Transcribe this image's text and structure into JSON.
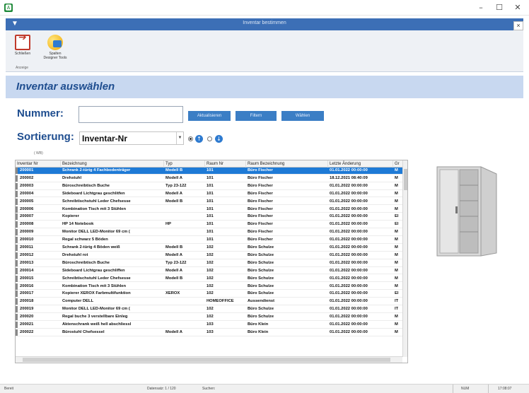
{
  "window": {
    "app_icon": "🅰",
    "minimize": "–",
    "maximize": "☐",
    "close": "✕"
  },
  "ribbon_window": {
    "qat": "▼",
    "caption": "Inventar bestimmen",
    "close": "×",
    "buttons": [
      {
        "label": "Schließen",
        "icon": "exit-icon"
      },
      {
        "label": "Spalten Designer Tools",
        "icon": "designer-icon"
      }
    ],
    "group_label": "Anzeige"
  },
  "heading": "Inventar auswählen",
  "search": {
    "nummer_label": "Nummer:",
    "nummer_value": "",
    "buttons": [
      "Aktualisieren",
      "Filtern",
      "Wählen"
    ]
  },
  "sort": {
    "label": "Sortierung:",
    "selected": "Inventar-Nr",
    "order": "ascending"
  },
  "tiny_label": "( WB)",
  "grid": {
    "columns": [
      "Inventar Nr",
      "Bezeichnung",
      "Typ",
      "Raum Nr",
      "Raum Bezeichnung",
      "Letzte Änderung",
      "Gr"
    ],
    "rows": [
      [
        "200001",
        "Schrank 2-türig 4 Fachbodenträger",
        "Modell B",
        "101",
        "Büro Fischer",
        "01.01.2022 00:00:00",
        "M"
      ],
      [
        "200002",
        "Drehstuhl",
        "Modell A",
        "101",
        "Büro Fischer",
        "18.12.2021 08:40:09",
        "M"
      ],
      [
        "200003",
        "Büroschreibtisch Buche",
        "Typ 23-122",
        "101",
        "Büro Fischer",
        "01.01.2022 00:00:00",
        "M"
      ],
      [
        "200004",
        "Sideboard Lichtgrau geschlitfen",
        "Modell A",
        "101",
        "Büro Fischer",
        "01.01.2022 00:00:00",
        "M"
      ],
      [
        "200005",
        "Schreibtischstuhl Leder Chefsesse",
        "Modell B",
        "101",
        "Büro Fischer",
        "01.01.2022 00:00:00",
        "M"
      ],
      [
        "200006",
        "Kombination Tisch mit 3 Stühlen",
        "",
        "101",
        "Büro Fischer",
        "01.01.2022 00:00:00",
        "M"
      ],
      [
        "200007",
        "Kopierer",
        "",
        "101",
        "Büro Fischer",
        "01.01.2022 00:00:00",
        "El"
      ],
      [
        "200008",
        "HP 14 Notebook",
        "HP",
        "101",
        "Büro Fischer",
        "01.01.2022 00:00:00",
        "El"
      ],
      [
        "200009",
        "Monitor DELL LED-Monitor 69 cm (",
        "",
        "101",
        "Büro Fischer",
        "01.01.2022 00:00:00",
        "M"
      ],
      [
        "200010",
        "Regal schwarz 5 Böden",
        "",
        "101",
        "Büro Fischer",
        "01.01.2022 00:00:00",
        "M"
      ],
      [
        "200011",
        "Schrank 2-türig 4 Böden weiß",
        "Modell B",
        "102",
        "Büro Schulze",
        "01.01.2022 00:00:00",
        "M"
      ],
      [
        "200012",
        "Drehstuhl rot",
        "Modell A",
        "102",
        "Büro Schulze",
        "01.01.2022 00:00:00",
        "M"
      ],
      [
        "200013",
        "Büroschreibtisch Buche",
        "Typ 23-122",
        "102",
        "Büro Schulze",
        "01.01.2022 00:00:00",
        "M"
      ],
      [
        "200014",
        "Sideboard Lichtgrau geschliffen",
        "Modell A",
        "102",
        "Büro Schulze",
        "01.01.2022 00:00:00",
        "M"
      ],
      [
        "200015",
        "Schreibtischstuhl Leder Chefsesse",
        "Modell B",
        "102",
        "Büro Schulze",
        "01.01.2022 00:00:00",
        "M"
      ],
      [
        "200016",
        "Kombination Tisch mit 3 Stühlen",
        "",
        "102",
        "Büro Schulze",
        "01.01.2022 00:00:00",
        "M"
      ],
      [
        "200017",
        "Kopierer XEROX Farbmultifunktion",
        "XEROX",
        "102",
        "Büro Schulze",
        "01.01.2022 00:00:00",
        "El"
      ],
      [
        "200018",
        "Computer DELL",
        "",
        "HOMEOFFICE",
        "Aussendienst",
        "01.01.2022 00:00:00",
        "IT"
      ],
      [
        "200019",
        "Monitor DELL LED-Monitor 69 cm (",
        "",
        "102",
        "Büro Schulze",
        "01.01.2022 00:00:00",
        "IT"
      ],
      [
        "200020",
        "Regal buche 3 verstellbare Einleg",
        "",
        "102",
        "Büro Schulze",
        "01.01.2022 00:00:00",
        "M"
      ],
      [
        "200021",
        "Aktenschrank weiß hell abschliessl",
        "",
        "103",
        "Büro Klein",
        "01.01.2022 00:00:00",
        "M"
      ],
      [
        "200022",
        "Bürostuhl Chefsessel",
        "Modell A",
        "103",
        "Büro Klein",
        "01.01.2022 00:00:00",
        "M"
      ]
    ]
  },
  "statusbar": [
    "Bereit",
    "Datensatz: 1 / 120",
    "Suchen:",
    "NUM",
    "17:08:07"
  ],
  "colors": {
    "ribbon_title": "#3c6fb6",
    "heading_band": "#c8d8f0",
    "heading_text": "#1e4d8f",
    "action_button": "#3b7ec5",
    "selected_row": "#1e7ad6"
  }
}
